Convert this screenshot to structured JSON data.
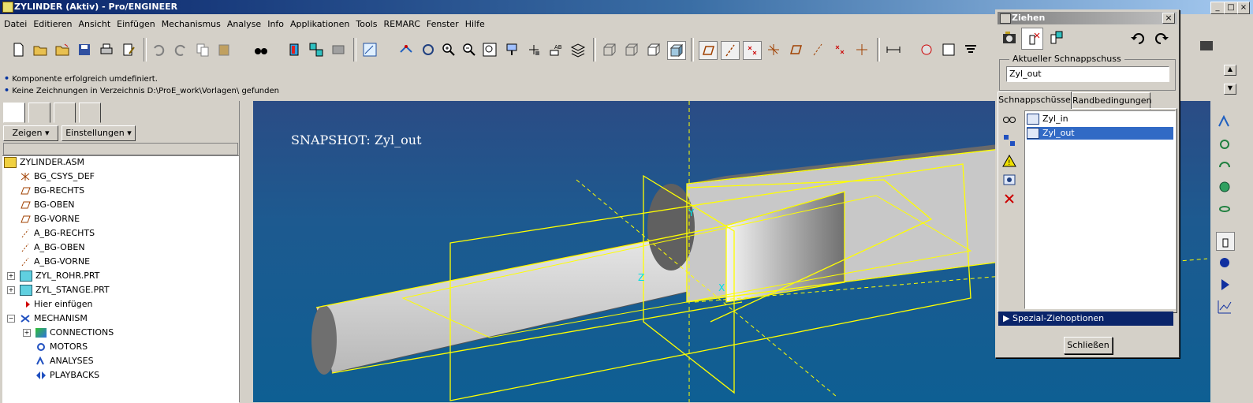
{
  "window": {
    "title": "ZYLINDER (Aktiv) - Pro/ENGINEER"
  },
  "menu": [
    "Datei",
    "Editieren",
    "Ansicht",
    "Einfügen",
    "Mechanismus",
    "Analyse",
    "Info",
    "Applikationen",
    "Tools",
    "REMARC",
    "Fenster",
    "Hilfe"
  ],
  "messages": [
    "Komponente erfolgreich umdefiniert.",
    "Keine Zeichnungen in Verzeichnis D:\\ProE_work\\Vorlagen\\ gefunden"
  ],
  "left_panel": {
    "show_button": "Zeigen",
    "settings_button": "Einstellungen",
    "tree": [
      {
        "label": "ZYLINDER.ASM",
        "icon": "assembly-icon"
      },
      {
        "label": "BG_CSYS_DEF",
        "icon": "csys-icon"
      },
      {
        "label": "BG-RECHTS",
        "icon": "datum-plane-icon"
      },
      {
        "label": "BG-OBEN",
        "icon": "datum-plane-icon"
      },
      {
        "label": "BG-VORNE",
        "icon": "datum-plane-icon"
      },
      {
        "label": "A_BG-RECHTS",
        "icon": "datum-axis-icon"
      },
      {
        "label": "A_BG-OBEN",
        "icon": "datum-axis-icon"
      },
      {
        "label": "A_BG-VORNE",
        "icon": "datum-axis-icon"
      },
      {
        "label": "ZYL_ROHR.PRT",
        "icon": "part-icon"
      },
      {
        "label": "ZYL_STANGE.PRT",
        "icon": "part-icon"
      },
      {
        "label": "Hier einfügen",
        "icon": "insert-arrow-icon"
      },
      {
        "label": "MECHANISM",
        "icon": "mechanism-icon"
      },
      {
        "label": "CONNECTIONS",
        "icon": "connections-icon"
      },
      {
        "label": "MOTORS",
        "icon": "motors-icon"
      },
      {
        "label": "ANALYSES",
        "icon": "analyses-icon"
      },
      {
        "label": "PLAYBACKS",
        "icon": "playbacks-icon"
      }
    ]
  },
  "viewport": {
    "snapshot_label": "SNAPSHOT: Zyl_out",
    "axis_labels": [
      "Y",
      "Z",
      "X"
    ]
  },
  "dialog": {
    "title": "Ziehen",
    "close_x": "×",
    "group_label": "Aktueller Schnappschuss",
    "current_snapshot": "Zyl_out",
    "tabs": [
      "Schnappschüsse",
      "Randbedingungen"
    ],
    "snapshots": [
      "Zyl_in",
      "Zyl_out"
    ],
    "selected_snapshot": "Zyl_out",
    "special_options": "Spezial-Ziehoptionen",
    "close_button": "Schließen"
  },
  "colors": {
    "selection": "#316ac5",
    "model_edges": "#ffff00",
    "viewport_bg": "#1b5a8e"
  }
}
